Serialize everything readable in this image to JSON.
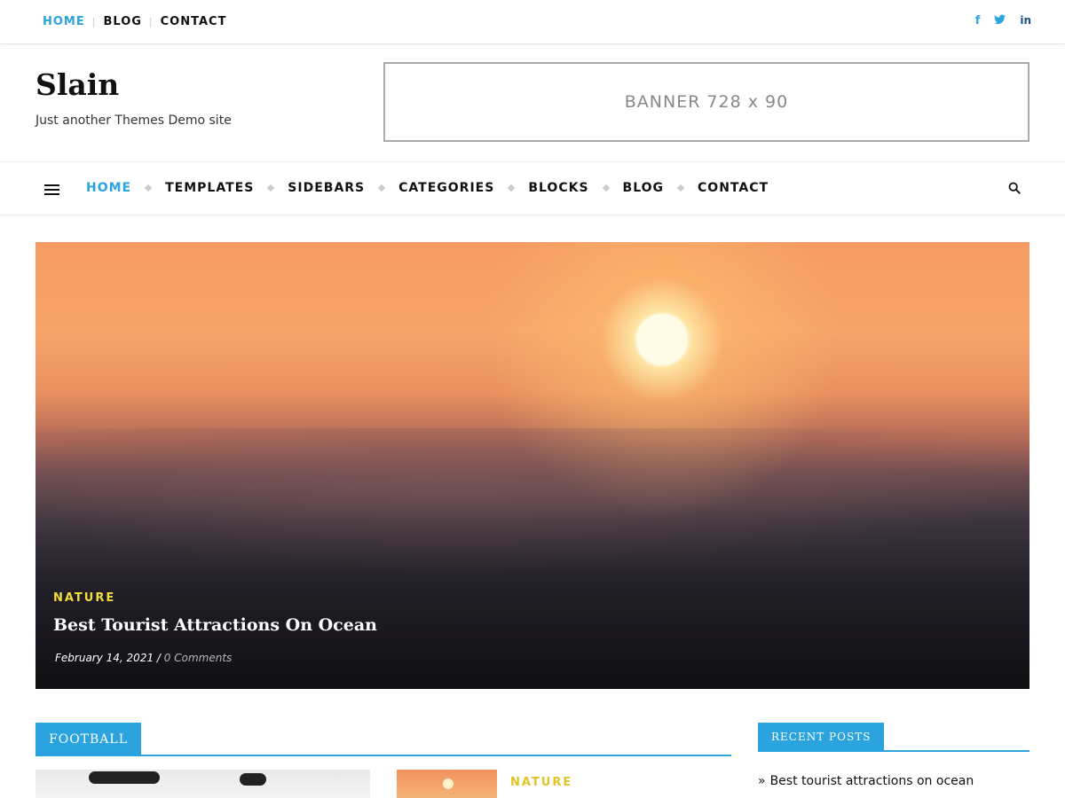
{
  "topbar": {
    "links": [
      {
        "label": "HOME",
        "active": true
      },
      {
        "label": "BLOG",
        "active": false
      },
      {
        "label": "CONTACT",
        "active": false
      }
    ],
    "social": [
      {
        "icon": "facebook-icon",
        "glyph": "f",
        "color": "#2aa3df"
      },
      {
        "icon": "twitter-icon",
        "glyph": "🐦",
        "color": "#2aa3df"
      },
      {
        "icon": "linkedin-icon",
        "glyph": "in",
        "color": "#1c4f86"
      }
    ]
  },
  "header": {
    "site_title": "Slain",
    "tagline": "Just another Themes Demo site",
    "banner_text": "BANNER 728 x 90"
  },
  "nav": {
    "items": [
      "HOME",
      "TEMPLATES",
      "SIDEBARS",
      "CATEGORIES",
      "BLOCKS",
      "BLOG",
      "CONTACT"
    ],
    "active_index": 0
  },
  "hero": {
    "category": "NATURE",
    "title": "Best Tourist Attractions On Ocean",
    "date": "February 14, 2021",
    "separator": "/",
    "comments": "0 Comments"
  },
  "football": {
    "section_label": "FOOTBALL",
    "post_category": "NATURE"
  },
  "sidebar": {
    "recent_label": "RECENT POSTS",
    "recent_posts": [
      "Best tourist attractions on ocean"
    ]
  },
  "colors": {
    "accent": "#2aa3df",
    "category": "#f2dd3e"
  }
}
